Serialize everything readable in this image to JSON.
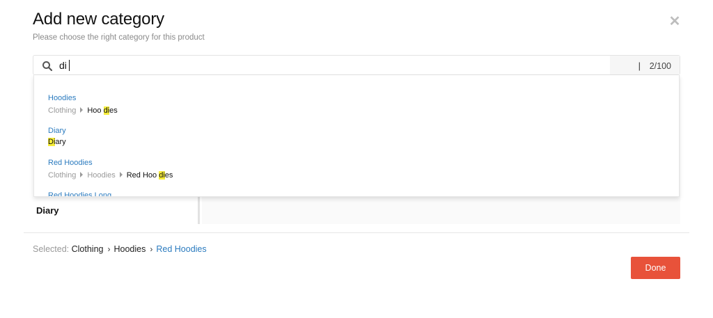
{
  "dialog": {
    "title": "Add new category",
    "subtitle": "Please choose the right category for this product",
    "close_icon": "close-icon"
  },
  "search": {
    "value": "di",
    "placeholder": "",
    "separator": "|",
    "counter": "2/100",
    "icon": "search-icon"
  },
  "results": [
    {
      "title": "Hoodies",
      "path_muted": [
        "Clothing"
      ],
      "current_before": "Hoo ",
      "current_match": "di",
      "current_after": "es"
    },
    {
      "title": "Diary",
      "path_muted": [],
      "current_before": "",
      "current_match": "Di",
      "current_after": "ary"
    },
    {
      "title": "Red Hoodies",
      "path_muted": [
        "Clothing",
        "Hoodies"
      ],
      "current_before": "Red Hoo ",
      "current_match": "di",
      "current_after": "es"
    },
    {
      "title": "Red Hoodies Long"
    }
  ],
  "underlay": {
    "visible_item": "Diary"
  },
  "selection": {
    "label": "Selected:",
    "crumbs": [
      "Clothing",
      "Hoodies",
      "Red Hoodies"
    ],
    "chevron": "›"
  },
  "actions": {
    "done_label": "Done",
    "done_color": "#e8523a"
  },
  "colors": {
    "link": "#2b7bbf",
    "highlight": "#f5ec3a",
    "muted": "#9a9a9a"
  }
}
